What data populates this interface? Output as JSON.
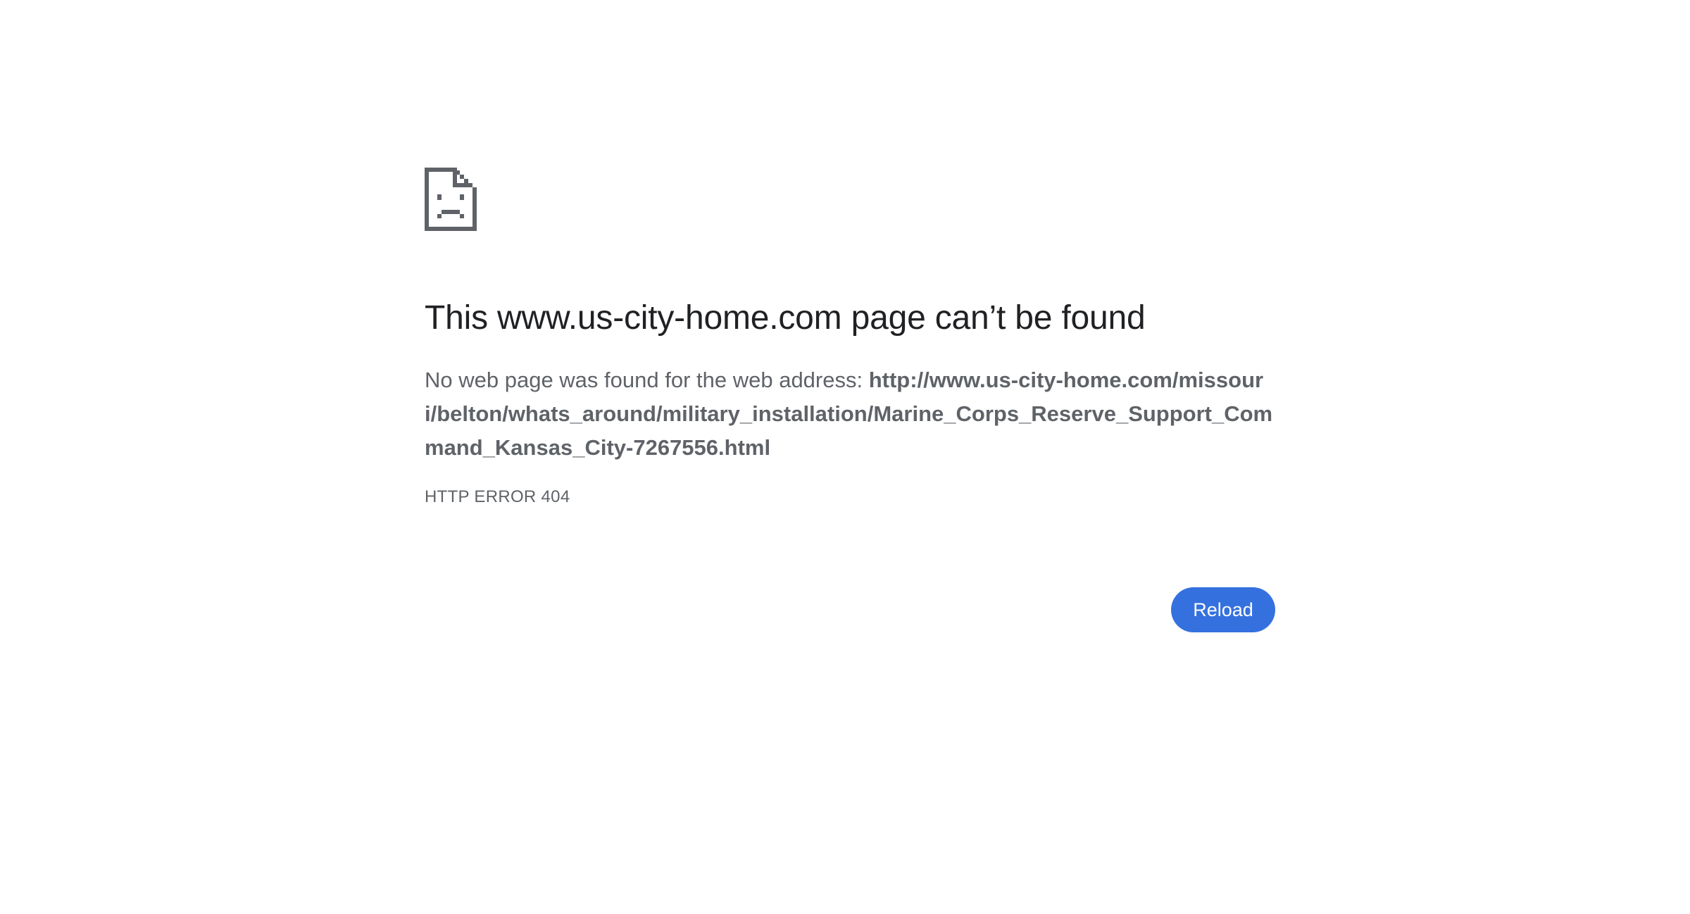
{
  "icon": "sad-page-icon",
  "title": "This www.us-city-home.com page can’t be found",
  "message": {
    "prefix": "No web page was found for the web address: ",
    "url": "http://www.us-city-home.com/missouri/belton/whats_around/military_installation/Marine_Corps_Reserve_Support_Command_Kansas_City-7267556.html"
  },
  "error_code": "HTTP ERROR 404",
  "reload_label": "Reload",
  "colors": {
    "icon": "#5f6368",
    "title": "#202124",
    "body_text": "#5f6368",
    "button_bg": "#3571de",
    "button_text": "#ffffff"
  }
}
